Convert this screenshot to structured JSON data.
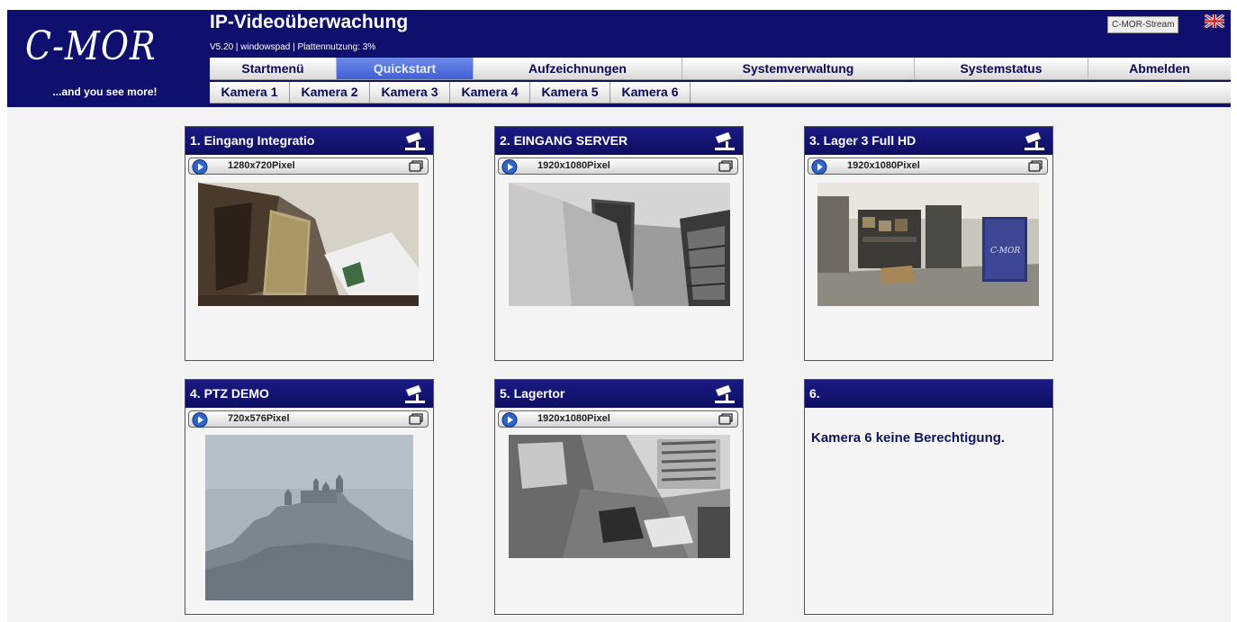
{
  "header": {
    "logo_text": "C-MOR",
    "slogan": "...and you see more!",
    "title": "IP-Videoüberwachung",
    "subtitle": "V5.20 | windowspad | Plattennutzung: 3%",
    "stream_button": "C-MOR-Stream",
    "language_icon": "uk-flag-icon"
  },
  "nav": {
    "items": [
      {
        "label": "Startmenü",
        "active": false
      },
      {
        "label": "Quickstart",
        "active": true
      },
      {
        "label": "Aufzeichnungen",
        "active": false
      },
      {
        "label": "Systemverwaltung",
        "active": false
      },
      {
        "label": "Systemstatus",
        "active": false
      },
      {
        "label": "Abmelden",
        "active": false
      }
    ]
  },
  "camera_tabs": [
    "Kamera 1",
    "Kamera 2",
    "Kamera 3",
    "Kamera 4",
    "Kamera 5",
    "Kamera 6"
  ],
  "cameras": [
    {
      "title": "1. Eingang Integratio",
      "resolution": "1280x720Pixel",
      "scene": "hallway-door"
    },
    {
      "title": "2. EINGANG SERVER",
      "resolution": "1920x1080Pixel",
      "scene": "server-entrance"
    },
    {
      "title": "3. Lager 3 Full HD",
      "resolution": "1920x1080Pixel",
      "scene": "warehouse"
    },
    {
      "title": "4. PTZ DEMO",
      "resolution": "720x576Pixel",
      "scene": "castle-hill"
    },
    {
      "title": "5. Lagertor",
      "resolution": "1920x1080Pixel",
      "scene": "gate-overhead"
    },
    {
      "title": "6.",
      "message": "Kamera 6 keine Berechtigung."
    }
  ],
  "colors": {
    "header_bg": "#0f0f6e",
    "active_nav": "#4a67db",
    "panel_border": "#555555"
  }
}
